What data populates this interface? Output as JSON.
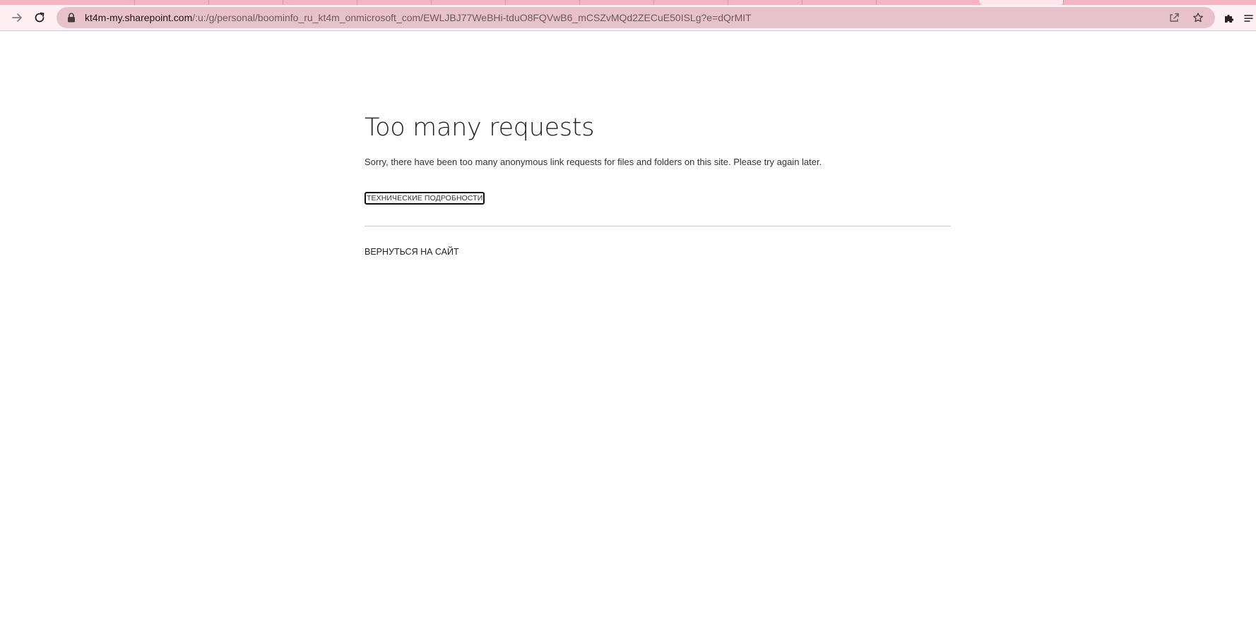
{
  "browser": {
    "url_host": "kt4m-my.sharepoint.com",
    "url_path": "/:u:/g/personal/boominfo_ru_kt4m_onmicrosoft_com/EWLJBJ77WeBHi-tduO8FQVwB6_mCSZvMQd2ZECuE50ISLg?e=dQrMIT",
    "icons": {
      "forward": "arrow-right-icon",
      "reload": "reload-icon",
      "lock": "lock-icon",
      "share": "share-icon",
      "bookmark": "star-icon",
      "extensions": "puzzle-icon",
      "reading_list": "reading-list-icon"
    },
    "theme": {
      "tabstrip": "#f6b3c3",
      "toolbar": "#fff0f3",
      "omnibox": "#e8c2cb"
    }
  },
  "page": {
    "title": "Too many requests",
    "message": "Sorry, there have been too many anonymous link requests for files and folders on this site. Please try again later.",
    "tech_details_label": "ТЕХНИЧЕСКИЕ ПОДРОБНОСТИ",
    "back_link_label": "ВЕРНУТЬСЯ НА САЙТ"
  }
}
